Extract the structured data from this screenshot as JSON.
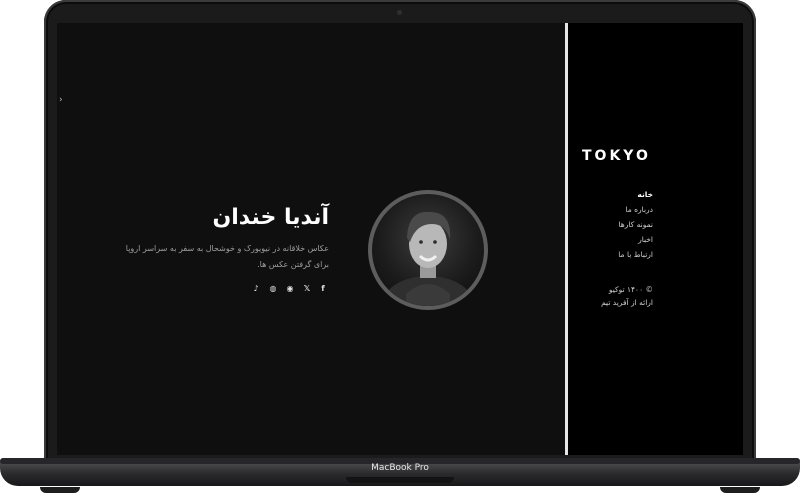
{
  "hero": {
    "name": "آندیا خندان",
    "description": "عکاس خلاقانه در نیویورک و خوشحال به سفر به سراسر اروپا برای گرفتن عکس ها."
  },
  "social_icons": [
    {
      "name": "facebook-icon",
      "glyph": "f"
    },
    {
      "name": "twitter-icon",
      "glyph": "𝕏"
    },
    {
      "name": "instagram-icon",
      "glyph": "◉"
    },
    {
      "name": "dribbble-icon",
      "glyph": "◍"
    },
    {
      "name": "tiktok-icon",
      "glyph": "♪"
    }
  ],
  "sidebar": {
    "logo": "TOKYO",
    "menu": [
      {
        "label": "خانه",
        "active": true
      },
      {
        "label": "درباره ما",
        "active": false
      },
      {
        "label": "نمونه کارها",
        "active": false
      },
      {
        "label": "اخبار",
        "active": false
      },
      {
        "label": "ارتباط با ما",
        "active": false
      }
    ],
    "copyright_line1": "© ۱۴۰۰ توکیو",
    "copyright_line2": "ارائه از آفرید تیم"
  },
  "device": {
    "brand": "MacBook Pro"
  },
  "colors": {
    "background": "#0f0f0f",
    "sidebar": "#000000",
    "text": "#ffffff",
    "muted_text": "#9e9e9e"
  }
}
